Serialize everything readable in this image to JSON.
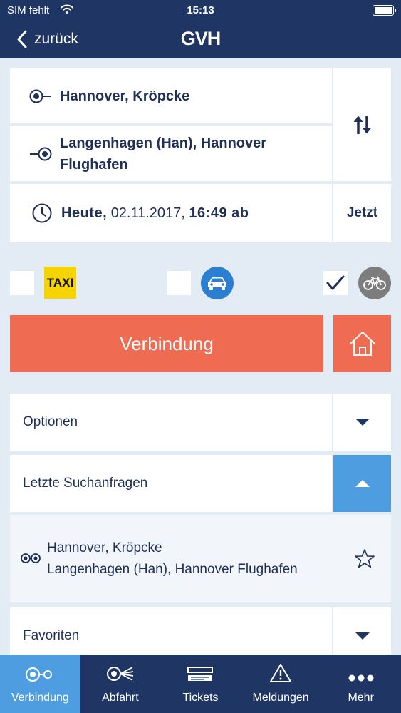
{
  "status_bar": {
    "carrier": "SIM fehlt",
    "time": "15:13",
    "battery_level": 1.0
  },
  "nav": {
    "back_label": "zurück",
    "brand": "GVH"
  },
  "search": {
    "origin": "Hannover, Kröpcke",
    "destination_line1": "Langenhagen (Han), Hannover",
    "destination_line2": "Flughafen",
    "date_day": "Heute,",
    "date": "02.11.2017,",
    "time": "16:49 ab",
    "now_label": "Jetzt"
  },
  "modes": {
    "taxi": {
      "label": "TAXI",
      "checked": false
    },
    "car": {
      "icon": "car-icon",
      "checked": false
    },
    "bike": {
      "icon": "bicycle-icon",
      "checked": true
    }
  },
  "actions": {
    "connect_label": "Verbindung",
    "home_icon": "home-icon"
  },
  "sections": {
    "options": {
      "label": "Optionen",
      "expanded": false
    },
    "recent": {
      "label": "Letzte Suchanfragen",
      "expanded": true,
      "items": [
        {
          "from": "Hannover, Kröpcke",
          "to": "Langenhagen (Han), Hannover Flughafen"
        }
      ]
    },
    "favorites": {
      "label": "Favoriten",
      "expanded": false
    }
  },
  "tabbar": {
    "tabs": [
      {
        "label": "Verbindung",
        "icon": "connection-icon",
        "active": true
      },
      {
        "label": "Abfahrt",
        "icon": "departure-icon",
        "active": false
      },
      {
        "label": "Tickets",
        "icon": "tickets-icon",
        "active": false
      },
      {
        "label": "Meldungen",
        "icon": "warning-icon",
        "active": false
      },
      {
        "label": "Mehr",
        "icon": "more-icon",
        "active": false
      }
    ]
  },
  "colors": {
    "navy": "#1f3563",
    "accent_orange": "#ef6c52",
    "active_blue": "#4e9de0",
    "taxi_yellow": "#f6d400",
    "background": "#e3ecf5"
  }
}
